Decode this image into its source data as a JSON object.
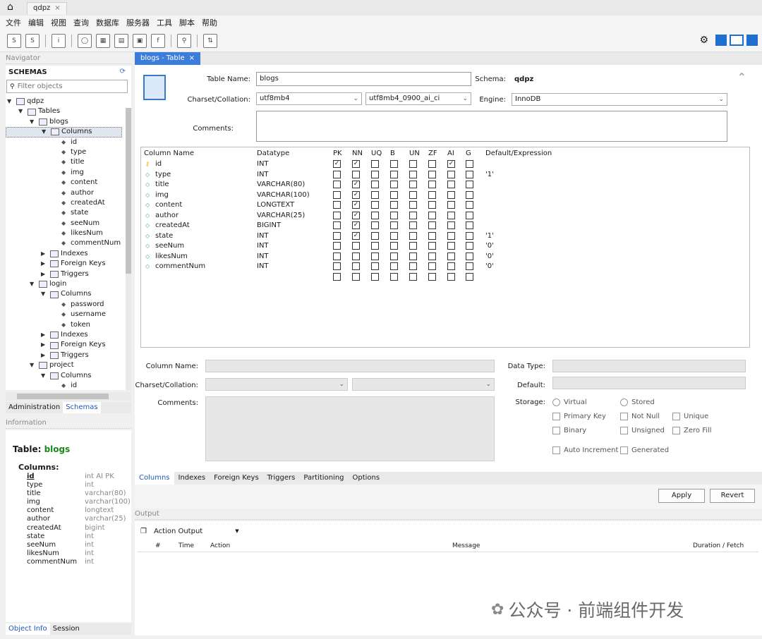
{
  "app": {
    "connection_tab": "qdpz",
    "close_glyph": "×"
  },
  "menu": [
    "文件",
    "编辑",
    "视图",
    "查询",
    "数据库",
    "服务器",
    "工具",
    "脚本",
    "帮助"
  ],
  "navigator": {
    "header": "Navigator",
    "schemas_title": "SCHEMAS",
    "filter_placeholder": "Filter objects",
    "tree": [
      {
        "level": 0,
        "caret": "▼",
        "icon": "db",
        "label": "qdpz"
      },
      {
        "level": 1,
        "caret": "▼",
        "icon": "folder",
        "label": "Tables"
      },
      {
        "level": 2,
        "caret": "▼",
        "icon": "table",
        "label": "blogs"
      },
      {
        "level": 3,
        "caret": "▼",
        "icon": "folder",
        "label": "Columns",
        "selected": true
      },
      {
        "level": 4,
        "caret": "",
        "icon": "col",
        "label": "id"
      },
      {
        "level": 4,
        "caret": "",
        "icon": "col",
        "label": "type"
      },
      {
        "level": 4,
        "caret": "",
        "icon": "col",
        "label": "title"
      },
      {
        "level": 4,
        "caret": "",
        "icon": "col",
        "label": "img"
      },
      {
        "level": 4,
        "caret": "",
        "icon": "col",
        "label": "content"
      },
      {
        "level": 4,
        "caret": "",
        "icon": "col",
        "label": "author"
      },
      {
        "level": 4,
        "caret": "",
        "icon": "col",
        "label": "createdAt"
      },
      {
        "level": 4,
        "caret": "",
        "icon": "col",
        "label": "state"
      },
      {
        "level": 4,
        "caret": "",
        "icon": "col",
        "label": "seeNum"
      },
      {
        "level": 4,
        "caret": "",
        "icon": "col",
        "label": "likesNum"
      },
      {
        "level": 4,
        "caret": "",
        "icon": "col",
        "label": "commentNum"
      },
      {
        "level": 3,
        "caret": "▶",
        "icon": "folder",
        "label": "Indexes"
      },
      {
        "level": 3,
        "caret": "▶",
        "icon": "folder",
        "label": "Foreign Keys"
      },
      {
        "level": 3,
        "caret": "▶",
        "icon": "folder",
        "label": "Triggers"
      },
      {
        "level": 2,
        "caret": "▼",
        "icon": "table",
        "label": "login"
      },
      {
        "level": 3,
        "caret": "▼",
        "icon": "folder",
        "label": "Columns"
      },
      {
        "level": 4,
        "caret": "",
        "icon": "col",
        "label": "password"
      },
      {
        "level": 4,
        "caret": "",
        "icon": "col",
        "label": "username"
      },
      {
        "level": 4,
        "caret": "",
        "icon": "col",
        "label": "token"
      },
      {
        "level": 3,
        "caret": "▶",
        "icon": "folder",
        "label": "Indexes"
      },
      {
        "level": 3,
        "caret": "▶",
        "icon": "folder",
        "label": "Foreign Keys"
      },
      {
        "level": 3,
        "caret": "▶",
        "icon": "folder",
        "label": "Triggers"
      },
      {
        "level": 2,
        "caret": "▼",
        "icon": "table",
        "label": "project"
      },
      {
        "level": 3,
        "caret": "▼",
        "icon": "folder",
        "label": "Columns"
      },
      {
        "level": 4,
        "caret": "",
        "icon": "col",
        "label": "id"
      }
    ],
    "tabs": [
      "Administration",
      "Schemas"
    ],
    "active_tab": "Schemas"
  },
  "information": {
    "header": "Information",
    "table_prefix": "Table:",
    "table_name": "blogs",
    "columns_title": "Columns:",
    "columns": [
      {
        "name": "id",
        "type": "int AI PK"
      },
      {
        "name": "type",
        "type": "int"
      },
      {
        "name": "title",
        "type": "varchar(80)"
      },
      {
        "name": "img",
        "type": "varchar(100)"
      },
      {
        "name": "content",
        "type": "longtext"
      },
      {
        "name": "author",
        "type": "varchar(25)"
      },
      {
        "name": "createdAt",
        "type": "bigint"
      },
      {
        "name": "state",
        "type": "int"
      },
      {
        "name": "seeNum",
        "type": "int"
      },
      {
        "name": "likesNum",
        "type": "int"
      },
      {
        "name": "commentNum",
        "type": "int"
      }
    ],
    "tabs": [
      "Object Info",
      "Session"
    ]
  },
  "editor": {
    "tab_title": "blogs - Table",
    "table_name_label": "Table Name:",
    "table_name": "blogs",
    "schema_label": "Schema:",
    "schema": "qdpz",
    "charset_label": "Charset/Collation:",
    "charset": "utf8mb4",
    "collation": "utf8mb4_0900_ai_ci",
    "engine_label": "Engine:",
    "engine": "InnoDB",
    "comments_label": "Comments:",
    "grid_headers": [
      "Column Name",
      "Datatype",
      "PK",
      "NN",
      "UQ",
      "B",
      "UN",
      "ZF",
      "AI",
      "G",
      "Default/Expression"
    ],
    "rows": [
      {
        "name": "id",
        "type": "INT",
        "flags": [
          1,
          1,
          0,
          0,
          0,
          0,
          1,
          0
        ],
        "default": "",
        "pk": true
      },
      {
        "name": "type",
        "type": "INT",
        "flags": [
          0,
          0,
          0,
          0,
          0,
          0,
          0,
          0
        ],
        "default": "'1'"
      },
      {
        "name": "title",
        "type": "VARCHAR(80)",
        "flags": [
          0,
          1,
          0,
          0,
          0,
          0,
          0,
          0
        ],
        "default": ""
      },
      {
        "name": "img",
        "type": "VARCHAR(100)",
        "flags": [
          0,
          1,
          0,
          0,
          0,
          0,
          0,
          0
        ],
        "default": ""
      },
      {
        "name": "content",
        "type": "LONGTEXT",
        "flags": [
          0,
          1,
          0,
          0,
          0,
          0,
          0,
          0
        ],
        "default": ""
      },
      {
        "name": "author",
        "type": "VARCHAR(25)",
        "flags": [
          0,
          1,
          0,
          0,
          0,
          0,
          0,
          0
        ],
        "default": ""
      },
      {
        "name": "createdAt",
        "type": "BIGINT",
        "flags": [
          0,
          1,
          0,
          0,
          0,
          0,
          0,
          0
        ],
        "default": ""
      },
      {
        "name": "state",
        "type": "INT",
        "flags": [
          0,
          1,
          0,
          0,
          0,
          0,
          0,
          0
        ],
        "default": "'1'"
      },
      {
        "name": "seeNum",
        "type": "INT",
        "flags": [
          0,
          0,
          0,
          0,
          0,
          0,
          0,
          0
        ],
        "default": "'0'"
      },
      {
        "name": "likesNum",
        "type": "INT",
        "flags": [
          0,
          0,
          0,
          0,
          0,
          0,
          0,
          0
        ],
        "default": "'0'"
      },
      {
        "name": "commentNum",
        "type": "INT",
        "flags": [
          0,
          0,
          0,
          0,
          0,
          0,
          0,
          0
        ],
        "default": "'0'"
      },
      {
        "name": "",
        "type": "",
        "flags": [
          0,
          0,
          0,
          0,
          0,
          0,
          0,
          0
        ],
        "default": ""
      }
    ],
    "detail": {
      "column_name_label": "Column Name:",
      "charset_label": "Charset/Collation:",
      "comments_label": "Comments:",
      "data_type_label": "Data Type:",
      "default_label": "Default:",
      "storage_label": "Storage:",
      "virtual": "Virtual",
      "stored": "Stored",
      "primary_key": "Primary Key",
      "not_null": "Not Null",
      "unique": "Unique",
      "binary": "Binary",
      "unsigned": "Unsigned",
      "zero_fill": "Zero Fill",
      "auto_increment": "Auto Increment",
      "generated": "Generated"
    },
    "bottom_tabs": [
      "Columns",
      "Indexes",
      "Foreign Keys",
      "Triggers",
      "Partitioning",
      "Options"
    ],
    "active_bottom_tab": "Columns",
    "apply": "Apply",
    "revert": "Revert"
  },
  "output": {
    "header": "Output",
    "selector": "Action Output",
    "columns": [
      "#",
      "Time",
      "Action",
      "Message",
      "Duration / Fetch"
    ]
  },
  "watermark": "公众号 · 前端组件开发"
}
